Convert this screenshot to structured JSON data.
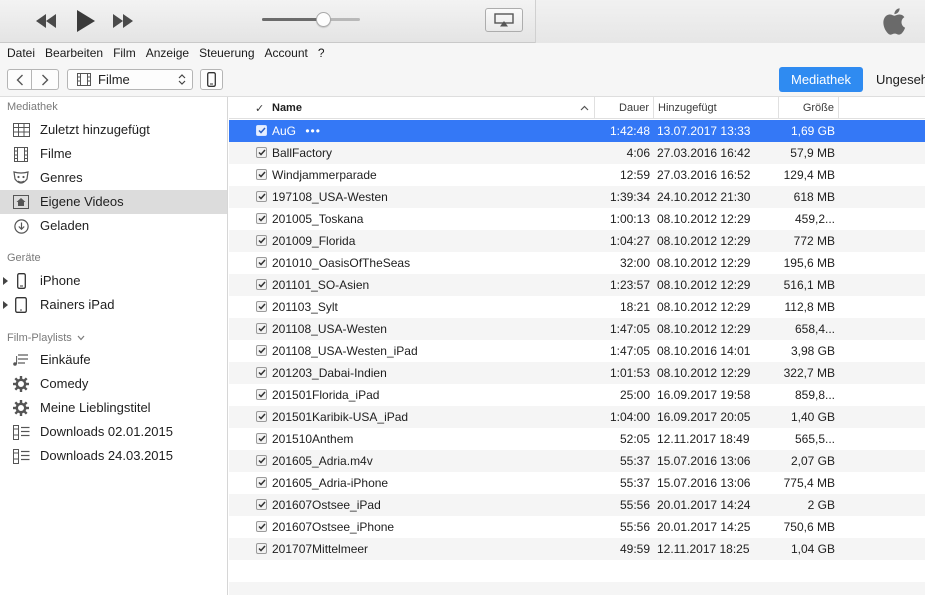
{
  "menu": [
    "Datei",
    "Bearbeiten",
    "Film",
    "Anzeige",
    "Steuerung",
    "Account",
    "?"
  ],
  "player": {
    "volume_fraction": 0.6
  },
  "nav": {
    "media_type": "Filme",
    "tab_library": "Mediathek",
    "tab_unseen": "Ungesehen"
  },
  "sidebar": {
    "library_heading": "Mediathek",
    "library": [
      {
        "label": "Zuletzt hinzugefügt",
        "icon": "grid-icon"
      },
      {
        "label": "Filme",
        "icon": "film-icon"
      },
      {
        "label": "Genres",
        "icon": "masks-icon"
      },
      {
        "label": "Eigene Videos",
        "icon": "home-video-icon",
        "selected": true
      },
      {
        "label": "Geladen",
        "icon": "download-icon"
      }
    ],
    "devices_heading": "Geräte",
    "devices": [
      {
        "label": "iPhone",
        "icon": "iphone-icon"
      },
      {
        "label": "Rainers iPad",
        "icon": "ipad-icon"
      }
    ],
    "playlists_heading": "Film-Playlists",
    "playlists": [
      {
        "label": "Einkäufe",
        "icon": "playlist-icon"
      },
      {
        "label": "Comedy",
        "icon": "smart-playlist-icon"
      },
      {
        "label": "Meine Lieblingstitel",
        "icon": "smart-playlist-icon"
      },
      {
        "label": "Downloads 02.01.2015",
        "icon": "playlist-icon"
      },
      {
        "label": "Downloads 24.03.2015",
        "icon": "playlist-icon"
      }
    ]
  },
  "table": {
    "columns": {
      "check": "✓",
      "name": "Name",
      "duration": "Dauer",
      "added": "Hinzugefügt",
      "size": "Größe"
    },
    "rows": [
      {
        "name": "AuG",
        "more": "•••",
        "duration": "1:42:48",
        "added": "13.07.2017 13:33",
        "size": "1,69 GB",
        "selected": true
      },
      {
        "name": "BallFactory",
        "duration": "4:06",
        "added": "27.03.2016 16:42",
        "size": "57,9 MB"
      },
      {
        "name": "Windjammerparade",
        "duration": "12:59",
        "added": "27.03.2016 16:52",
        "size": "129,4 MB"
      },
      {
        "name": "197108_USA-Westen",
        "duration": "1:39:34",
        "added": "24.10.2012 21:30",
        "size": "618 MB"
      },
      {
        "name": "201005_Toskana",
        "duration": "1:00:13",
        "added": "08.10.2012 12:29",
        "size": "459,2..."
      },
      {
        "name": "201009_Florida",
        "duration": "1:04:27",
        "added": "08.10.2012 12:29",
        "size": "772 MB"
      },
      {
        "name": "201010_OasisOfTheSeas",
        "duration": "32:00",
        "added": "08.10.2012 12:29",
        "size": "195,6 MB"
      },
      {
        "name": "201101_SO-Asien",
        "duration": "1:23:57",
        "added": "08.10.2012 12:29",
        "size": "516,1 MB"
      },
      {
        "name": "201103_Sylt",
        "duration": "18:21",
        "added": "08.10.2012 12:29",
        "size": "112,8 MB"
      },
      {
        "name": "201108_USA-Westen",
        "duration": "1:47:05",
        "added": "08.10.2012 12:29",
        "size": "658,4..."
      },
      {
        "name": "201108_USA-Westen_iPad",
        "duration": "1:47:05",
        "added": "08.10.2016 14:01",
        "size": "3,98 GB"
      },
      {
        "name": "201203_Dabai-Indien",
        "duration": "1:01:53",
        "added": "08.10.2012 12:29",
        "size": "322,7 MB"
      },
      {
        "name": "201501Florida_iPad",
        "duration": "25:00",
        "added": "16.09.2017 19:58",
        "size": "859,8..."
      },
      {
        "name": "201501Karibik-USA_iPad",
        "duration": "1:04:00",
        "added": "16.09.2017 20:05",
        "size": "1,40 GB"
      },
      {
        "name": "201510Anthem",
        "duration": "52:05",
        "added": "12.11.2017 18:49",
        "size": "565,5..."
      },
      {
        "name": "201605_Adria.m4v",
        "duration": "55:37",
        "added": "15.07.2016 13:06",
        "size": "2,07 GB"
      },
      {
        "name": "201605_Adria-iPhone",
        "duration": "55:37",
        "added": "15.07.2016 13:06",
        "size": "775,4 MB"
      },
      {
        "name": "201607Ostsee_iPad",
        "duration": "55:56",
        "added": "20.01.2017 14:24",
        "size": "2 GB"
      },
      {
        "name": "201607Ostsee_iPhone",
        "duration": "55:56",
        "added": "20.01.2017 14:25",
        "size": "750,6 MB"
      },
      {
        "name": "201707Mittelmeer",
        "duration": "49:59",
        "added": "12.11.2017 18:25",
        "size": "1,04 GB"
      }
    ]
  },
  "colors": {
    "accent": "#2f8bf1",
    "selection": "#3478f6"
  }
}
